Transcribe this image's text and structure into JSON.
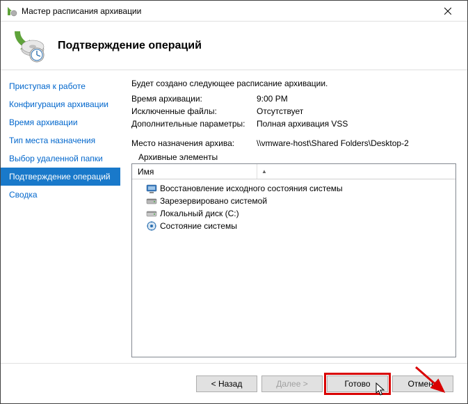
{
  "window": {
    "title": "Мастер расписания архивации"
  },
  "header": {
    "title": "Подтверждение операций"
  },
  "sidebar": {
    "items": [
      {
        "label": "Приступая к работе"
      },
      {
        "label": "Конфигурация архивации"
      },
      {
        "label": "Время архивации"
      },
      {
        "label": "Тип места назначения"
      },
      {
        "label": "Выбор удаленной папки"
      },
      {
        "label": "Подтверждение операций"
      },
      {
        "label": "Сводка"
      }
    ],
    "active_index": 5
  },
  "main": {
    "intro": "Будет создано следующее расписание архивации.",
    "rows": [
      {
        "label": "Время архивации:",
        "value": "9:00 PM"
      },
      {
        "label": "Исключенные файлы:",
        "value": "Отсутствует"
      },
      {
        "label": "Дополнительные параметры:",
        "value": "Полная архивация VSS"
      }
    ],
    "dest_label": "Место назначения архива:",
    "dest_value": "\\\\vmware-host\\Shared Folders\\Desktop-2",
    "archive_elements_label": "Архивные элементы",
    "list_header": "Имя",
    "list_items": [
      {
        "icon": "bmr-icon",
        "label": "Восстановление исходного состояния системы"
      },
      {
        "icon": "system-reserved-icon",
        "label": "Зарезервировано системой"
      },
      {
        "icon": "disk-icon",
        "label": "Локальный диск (C:)"
      },
      {
        "icon": "system-state-icon",
        "label": "Состояние системы"
      }
    ]
  },
  "footer": {
    "back": "< Назад",
    "next": "Далее >",
    "finish": "Готово",
    "cancel": "Отмена"
  }
}
